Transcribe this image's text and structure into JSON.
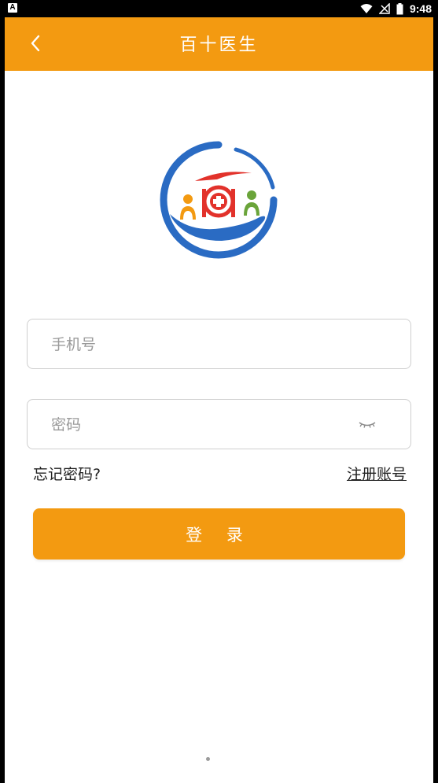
{
  "status_bar": {
    "left_badge": "A",
    "time": "9:48",
    "icons": [
      "wifi-icon",
      "signal-icon",
      "battery-icon"
    ]
  },
  "header": {
    "title": "百十医生",
    "back_icon": "chevron-left-icon"
  },
  "form": {
    "phone_placeholder": "手机号",
    "password_placeholder": "密码",
    "eye_icon": "eye-closed-icon"
  },
  "links": {
    "forgot": "忘记密码?",
    "register": "注册账号"
  },
  "login_button": "登 录",
  "colors": {
    "accent": "#f39a11",
    "logo_blue": "#2a6bc3",
    "logo_red": "#e2322b",
    "logo_orange": "#f39a11",
    "logo_green": "#6aa43a"
  }
}
